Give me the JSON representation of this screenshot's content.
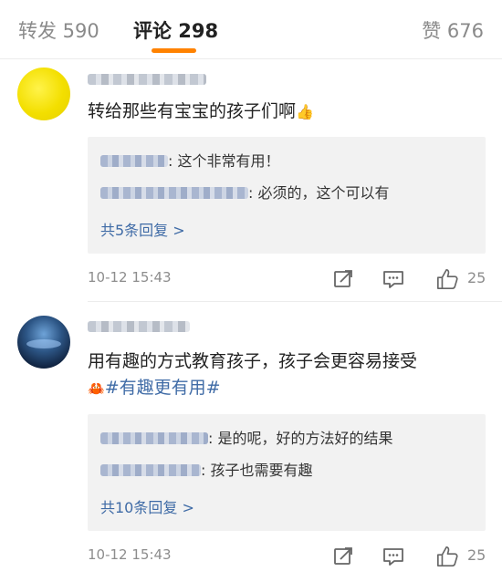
{
  "tabs": {
    "repost": "转发 590",
    "comment": "评论 298",
    "like": "赞 676"
  },
  "colors": {
    "accent": "#ff8200",
    "link": "#3f6ba6"
  },
  "comments": [
    {
      "avatar": "yellow-avatar",
      "text": "转给那些有宝宝的孩子们啊",
      "emoji": "thumbs-up-emoji",
      "replies": [
        {
          "text": ": 这个非常有用！"
        },
        {
          "text": ": 必须的，这个可以有"
        }
      ],
      "more_label": "共5条回复 >",
      "time": "10-12 15:43",
      "likes": "25"
    },
    {
      "avatar": "night-sky-avatar",
      "text": "用有趣的方式教育孩子，孩子会更容易接受",
      "emoji": "crab-emoji",
      "topic": "#有趣更有用#",
      "replies": [
        {
          "text": ": 是的呢，好的方法好的结果"
        },
        {
          "text": ": 孩子也需要有趣"
        }
      ],
      "more_label": "共10条回复 >",
      "time": "10-12 15:43",
      "likes": "25"
    }
  ]
}
